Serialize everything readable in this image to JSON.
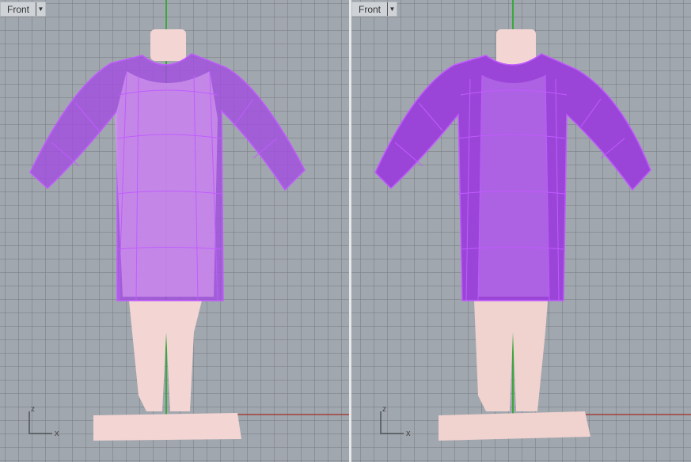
{
  "viewports": [
    {
      "title": "Front",
      "axis_z": "z",
      "axis_x": "x",
      "mode": "ghosted"
    },
    {
      "title": "Front",
      "axis_z": "z",
      "axis_x": "x",
      "mode": "shaded"
    }
  ],
  "colors": {
    "garment": "#9b45d8",
    "wire": "#c05cff",
    "body": "#f3d6d3",
    "y_axis": "#3ca83c",
    "x_axis": "#a0403c",
    "background": "#a1a7ae"
  }
}
